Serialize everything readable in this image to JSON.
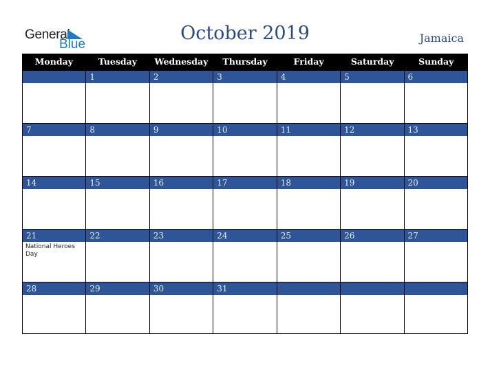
{
  "logo": {
    "general": "General",
    "blue": "Blue"
  },
  "title": "October 2019",
  "country": "Jamaica",
  "weekdays": [
    "Monday",
    "Tuesday",
    "Wednesday",
    "Thursday",
    "Friday",
    "Saturday",
    "Sunday"
  ],
  "weeks": [
    [
      {
        "d": ""
      },
      {
        "d": "1"
      },
      {
        "d": "2"
      },
      {
        "d": "3"
      },
      {
        "d": "4"
      },
      {
        "d": "5"
      },
      {
        "d": "6"
      }
    ],
    [
      {
        "d": "7"
      },
      {
        "d": "8"
      },
      {
        "d": "9"
      },
      {
        "d": "10"
      },
      {
        "d": "11"
      },
      {
        "d": "12"
      },
      {
        "d": "13"
      }
    ],
    [
      {
        "d": "14"
      },
      {
        "d": "15"
      },
      {
        "d": "16"
      },
      {
        "d": "17"
      },
      {
        "d": "18"
      },
      {
        "d": "19"
      },
      {
        "d": "20"
      }
    ],
    [
      {
        "d": "21",
        "e": "National Heroes Day"
      },
      {
        "d": "22"
      },
      {
        "d": "23"
      },
      {
        "d": "24"
      },
      {
        "d": "25"
      },
      {
        "d": "26"
      },
      {
        "d": "27"
      }
    ],
    [
      {
        "d": "28"
      },
      {
        "d": "29"
      },
      {
        "d": "30"
      },
      {
        "d": "31"
      },
      {
        "d": ""
      },
      {
        "d": ""
      },
      {
        "d": ""
      }
    ]
  ]
}
